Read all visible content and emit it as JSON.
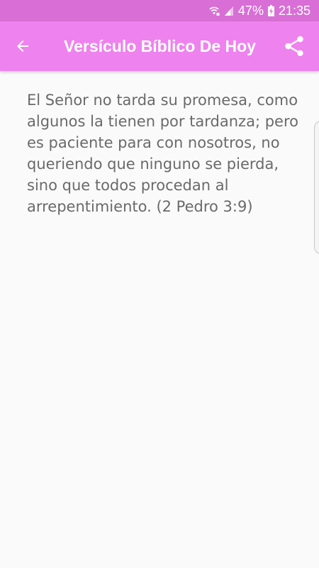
{
  "status_bar": {
    "battery": "47%",
    "time": "21:35",
    "icons": [
      "wifi-icon",
      "signal-icon",
      "battery-charging-icon"
    ]
  },
  "app_bar": {
    "title": "Versículo Bíblico De Hoy",
    "back_icon": "arrow-back-icon",
    "share_icon": "share-icon"
  },
  "content": {
    "verse": "El Señor no tarda su promesa, como algunos la tienen por tardanza; pero es paciente para con nosotros, no queriendo que ninguno se pierda, sino que todos procedan al arrepentimiento. (2 Pedro 3:9)"
  },
  "colors": {
    "status_bar": "#d96fd6",
    "app_bar": "#ee82ee",
    "background": "#fafafa",
    "text": "#6a6a6a"
  }
}
